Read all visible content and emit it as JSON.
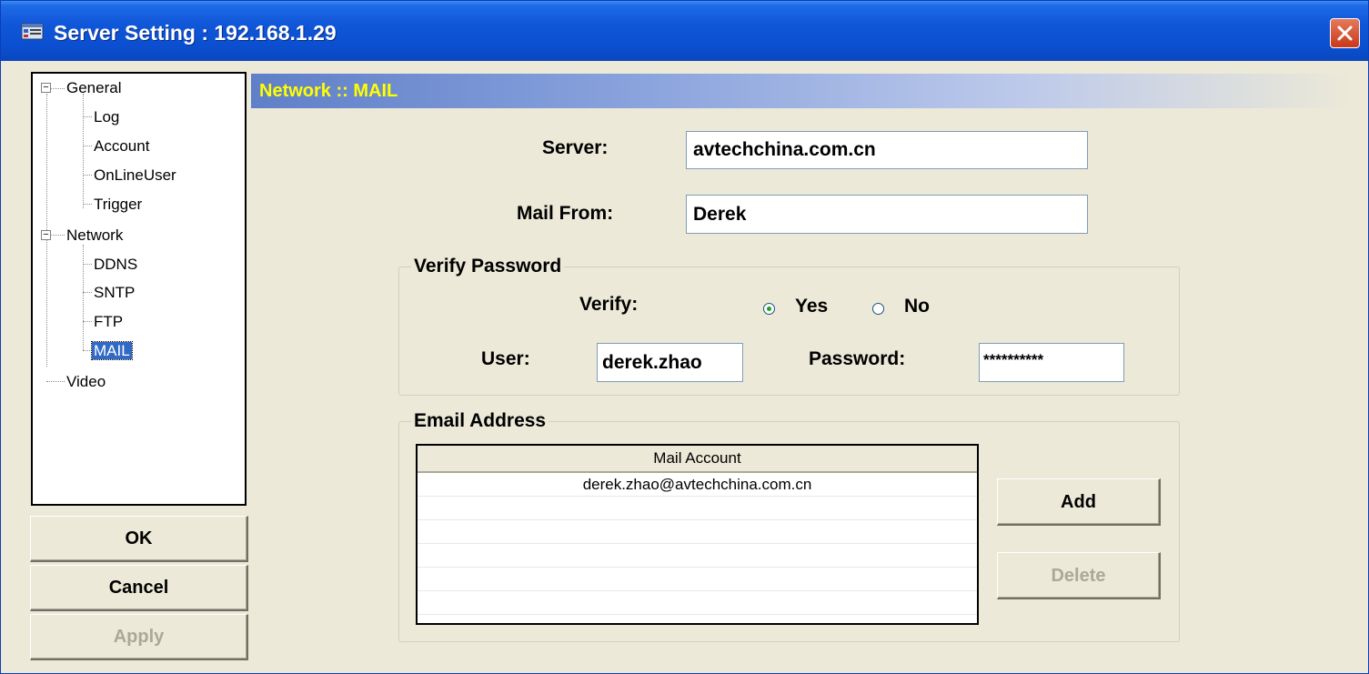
{
  "window": {
    "title": "Server Setting : 192.168.1.29",
    "icon": "server-app-icon",
    "close_icon": "close-x-icon"
  },
  "tree": {
    "general": {
      "label": "General",
      "expander": "−",
      "children": [
        {
          "label": "Log"
        },
        {
          "label": "Account"
        },
        {
          "label": "OnLineUser"
        },
        {
          "label": "Trigger"
        }
      ]
    },
    "network": {
      "label": "Network",
      "expander": "−",
      "children": [
        {
          "label": "DDNS"
        },
        {
          "label": "SNTP"
        },
        {
          "label": "FTP"
        },
        {
          "label": "MAIL",
          "selected": true
        }
      ]
    },
    "video": {
      "label": "Video"
    }
  },
  "buttons": {
    "ok": "OK",
    "cancel": "Cancel",
    "apply": "Apply",
    "apply_disabled": true
  },
  "panel": {
    "title": "Network :: MAIL",
    "title_color": "#ffff00"
  },
  "mail": {
    "server_label": "Server:",
    "server_value": "avtechchina.com.cn",
    "from_label": "Mail From:",
    "from_value": "Derek"
  },
  "verify": {
    "group_title": "Verify Password",
    "verify_label": "Verify:",
    "options": [
      {
        "label": "Yes",
        "selected": true
      },
      {
        "label": "No",
        "selected": false
      }
    ],
    "user_label": "User:",
    "user_value": "derek.zhao",
    "password_label": "Password:",
    "password_value": "**********"
  },
  "email": {
    "group_title": "Email Address",
    "column_header": "Mail Account",
    "rows": [
      "derek.zhao@avtechchina.com.cn"
    ],
    "add_label": "Add",
    "delete_label": "Delete",
    "delete_disabled": true
  }
}
